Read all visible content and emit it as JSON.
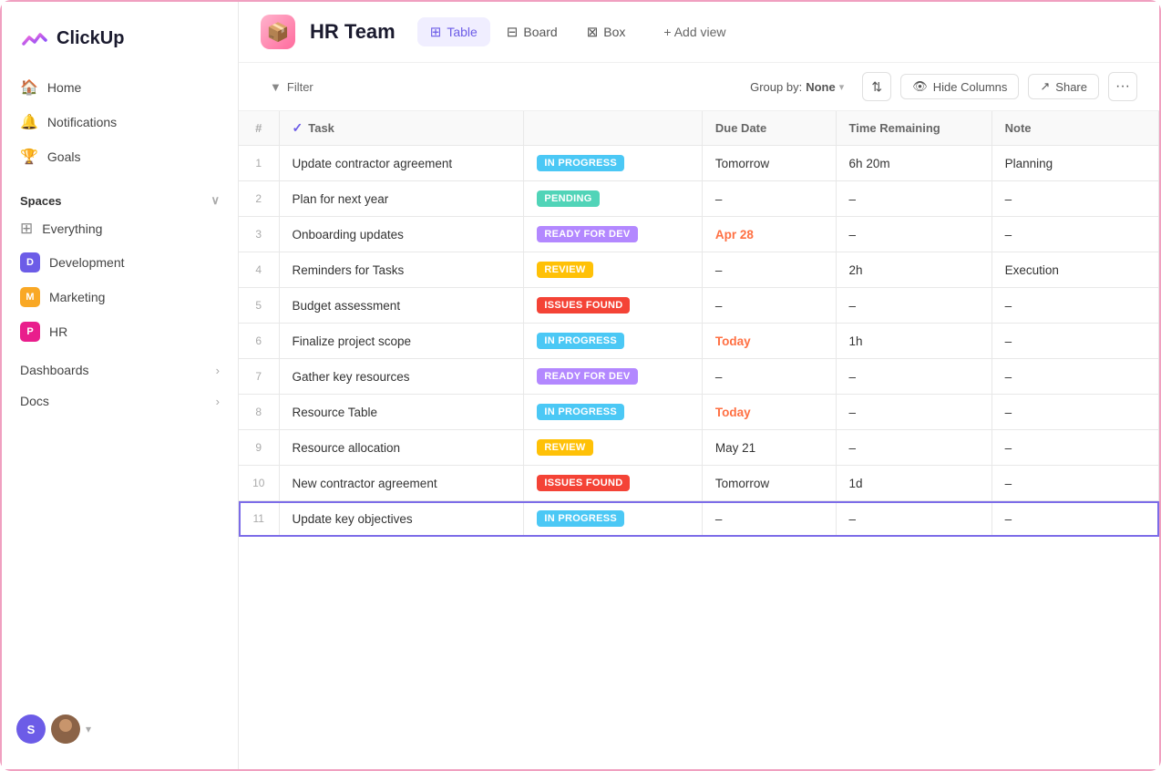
{
  "app": {
    "name": "ClickUp"
  },
  "sidebar": {
    "nav": [
      {
        "id": "home",
        "label": "Home",
        "icon": "🏠"
      },
      {
        "id": "notifications",
        "label": "Notifications",
        "icon": "🔔"
      },
      {
        "id": "goals",
        "label": "Goals",
        "icon": "🎯"
      }
    ],
    "spaces_label": "Spaces",
    "spaces": [
      {
        "id": "everything",
        "label": "Everything",
        "icon": "⊞",
        "color": null
      },
      {
        "id": "development",
        "label": "Development",
        "initial": "D",
        "color": "#6c5ce7"
      },
      {
        "id": "marketing",
        "label": "Marketing",
        "initial": "M",
        "color": "#f9a825"
      },
      {
        "id": "hr",
        "label": "HR",
        "initial": "P",
        "color": "#e91e8c"
      }
    ],
    "expandable": [
      {
        "id": "dashboards",
        "label": "Dashboards"
      },
      {
        "id": "docs",
        "label": "Docs"
      }
    ],
    "footer": {
      "initials": "S"
    }
  },
  "workspace": {
    "title": "HR Team",
    "icon": "📦"
  },
  "views": [
    {
      "id": "table",
      "label": "Table",
      "icon": "⊞",
      "active": true
    },
    {
      "id": "board",
      "label": "Board",
      "icon": "⊟"
    },
    {
      "id": "box",
      "label": "Box",
      "icon": "⊠"
    }
  ],
  "add_view_label": "+ Add view",
  "toolbar": {
    "filter_label": "Filter",
    "groupby_label": "Group by:",
    "groupby_value": "None",
    "hide_columns_label": "Hide Columns",
    "share_label": "Share"
  },
  "table": {
    "columns": [
      {
        "id": "num",
        "label": "#"
      },
      {
        "id": "task",
        "label": "Task"
      },
      {
        "id": "status",
        "label": ""
      },
      {
        "id": "duedate",
        "label": "Due Date"
      },
      {
        "id": "timeremaining",
        "label": "Time Remaining"
      },
      {
        "id": "note",
        "label": "Note"
      }
    ],
    "rows": [
      {
        "num": 1,
        "task": "Update contractor agreement",
        "status": "IN PROGRESS",
        "status_class": "in-progress",
        "due_date": "Tomorrow",
        "due_class": "normal",
        "time_remaining": "6h 20m",
        "note": "Planning"
      },
      {
        "num": 2,
        "task": "Plan for next year",
        "status": "PENDING",
        "status_class": "pending",
        "due_date": "–",
        "due_class": "normal",
        "time_remaining": "–",
        "note": "–"
      },
      {
        "num": 3,
        "task": "Onboarding updates",
        "status": "READY FOR DEV",
        "status_class": "ready-for-dev",
        "due_date": "Apr 28",
        "due_class": "highlight",
        "time_remaining": "–",
        "note": "–"
      },
      {
        "num": 4,
        "task": "Reminders for Tasks",
        "status": "REVIEW",
        "status_class": "review",
        "due_date": "–",
        "due_class": "normal",
        "time_remaining": "2h",
        "note": "Execution"
      },
      {
        "num": 5,
        "task": "Budget assessment",
        "status": "ISSUES FOUND",
        "status_class": "issues-found",
        "due_date": "–",
        "due_class": "normal",
        "time_remaining": "–",
        "note": "–"
      },
      {
        "num": 6,
        "task": "Finalize project scope",
        "status": "IN PROGRESS",
        "status_class": "in-progress",
        "due_date": "Today",
        "due_class": "highlight",
        "time_remaining": "1h",
        "note": "–"
      },
      {
        "num": 7,
        "task": "Gather key resources",
        "status": "READY FOR DEV",
        "status_class": "ready-for-dev",
        "due_date": "–",
        "due_class": "normal",
        "time_remaining": "–",
        "note": "–"
      },
      {
        "num": 8,
        "task": "Resource Table",
        "status": "IN PROGRESS",
        "status_class": "in-progress",
        "due_date": "Today",
        "due_class": "highlight",
        "time_remaining": "–",
        "note": "–"
      },
      {
        "num": 9,
        "task": "Resource allocation",
        "status": "REVIEW",
        "status_class": "review",
        "due_date": "May 21",
        "due_class": "normal",
        "time_remaining": "–",
        "note": "–"
      },
      {
        "num": 10,
        "task": "New contractor agreement",
        "status": "ISSUES FOUND",
        "status_class": "issues-found",
        "due_date": "Tomorrow",
        "due_class": "normal",
        "time_remaining": "1d",
        "note": "–"
      },
      {
        "num": 11,
        "task": "Update key objectives",
        "status": "IN PROGRESS",
        "status_class": "in-progress",
        "due_date": "–",
        "due_class": "normal",
        "time_remaining": "–",
        "note": "–",
        "selected": true
      }
    ]
  }
}
